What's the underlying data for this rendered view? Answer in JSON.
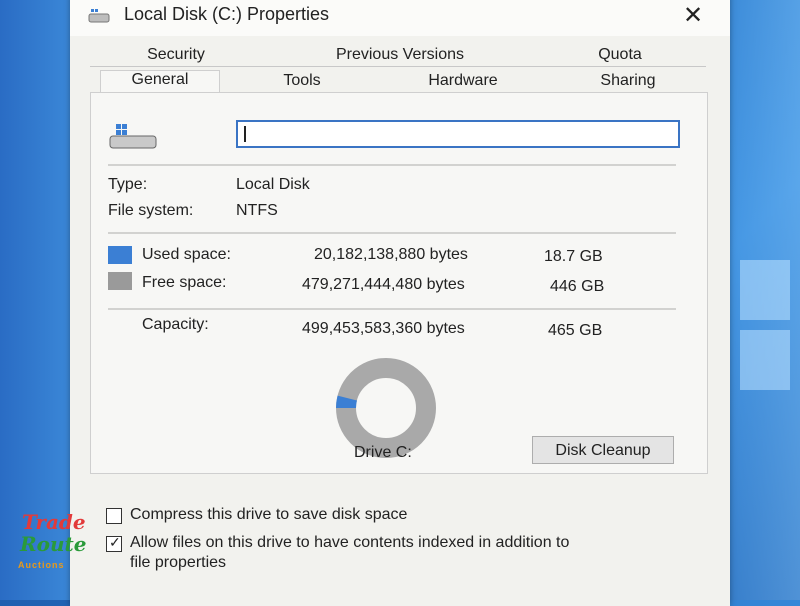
{
  "window": {
    "title": "Local Disk (C:) Properties",
    "close_label": "✕"
  },
  "tabs": {
    "row1": [
      "Security",
      "Previous Versions",
      "Quota"
    ],
    "row2": [
      "General",
      "Tools",
      "Hardware",
      "Sharing"
    ],
    "active": "General"
  },
  "general": {
    "name_value": "",
    "type_label": "Type:",
    "type_value": "Local Disk",
    "fs_label": "File system:",
    "fs_value": "NTFS",
    "used": {
      "label": "Used space:",
      "bytes": "20,182,138,880 bytes",
      "size": "18.7 GB",
      "color": "#3b7fd4"
    },
    "free": {
      "label": "Free space:",
      "bytes": "479,271,444,480 bytes",
      "size": "446 GB",
      "color": "#9a9a9a"
    },
    "capacity": {
      "label": "Capacity:",
      "bytes": "499,453,583,360 bytes",
      "size": "465 GB"
    },
    "used_fraction": 0.04,
    "drive_label": "Drive C:",
    "cleanup_button": "Disk Cleanup"
  },
  "options": {
    "compress": {
      "label": "Compress this drive to save disk space",
      "checked": false
    },
    "index": {
      "label_line1": "Allow files on this drive to have contents indexed in addition to",
      "label_line2": "file properties",
      "checked": true
    }
  },
  "watermark": {
    "line1": "Trade",
    "line2": "Route",
    "line3": "Auctions"
  }
}
